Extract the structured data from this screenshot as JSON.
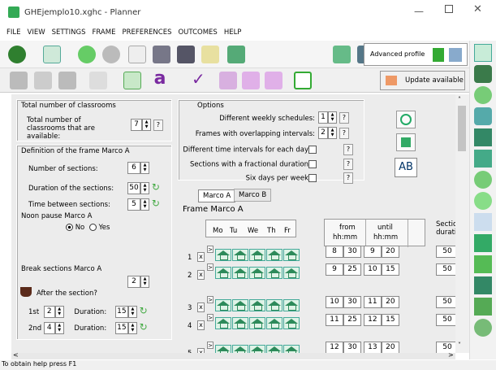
{
  "window": {
    "title": "GHEjemplo10.xghc - Planner"
  },
  "menu": [
    "FILE",
    "VIEW",
    "SETTINGS",
    "FRAME",
    "PREFERENCES",
    "OUTCOMES",
    "HELP"
  ],
  "toolbar": {
    "profile_label": "Advanced profile",
    "update_label": "Update available"
  },
  "classrooms": {
    "section_title": "Total number of classrooms",
    "label": "Total number of classrooms that are available:",
    "value": "7"
  },
  "frame_def": {
    "section_title": "Definition of the frame Marco A",
    "sections_label": "Number of sections:",
    "sections_value": "6",
    "duration_label": "Duration of the sections:",
    "duration_value": "50",
    "between_label": "Time between sections:",
    "between_value": "5"
  },
  "noon": {
    "title": "Noon pause Marco A",
    "no": "No",
    "yes": "Yes"
  },
  "breaks": {
    "title": "Break sections Marco A",
    "count": "2",
    "after_label": "After the section?",
    "rows": [
      {
        "label": "1st",
        "section": "2",
        "duration_label": "Duration:",
        "duration": "15"
      },
      {
        "label": "2nd",
        "section": "4",
        "duration_label": "Duration:",
        "duration": "15"
      }
    ]
  },
  "options": {
    "title": "Options",
    "items": [
      {
        "label": "Different weekly schedules:",
        "value": "1",
        "type": "spin"
      },
      {
        "label": "Frames with overlapping intervals:",
        "value": "2",
        "type": "spin"
      },
      {
        "label": "Different time intervals for each day",
        "type": "check"
      },
      {
        "label": "Sections with a fractional duration",
        "type": "check"
      },
      {
        "label": "Six days per week",
        "type": "check"
      }
    ]
  },
  "ab_label": "AB",
  "tabs": [
    "Marco A",
    "Marco B"
  ],
  "frame_title": "Frame  Marco A",
  "days": [
    "Mo",
    "Tu",
    "We",
    "Th",
    "Fr"
  ],
  "cols": {
    "from": "from",
    "until": "until",
    "hhmm": "hh:mm",
    "sections": "Sections",
    "duration": "duration"
  },
  "sections": [
    {
      "n": "1",
      "fh": "8",
      "fm": "30",
      "uh": "9",
      "um": "20",
      "dur": "50"
    },
    {
      "n": "2",
      "fh": "9",
      "fm": "25",
      "uh": "10",
      "um": "15",
      "dur": "50"
    },
    {
      "n": "3",
      "fh": "10",
      "fm": "30",
      "uh": "11",
      "um": "20",
      "dur": "50"
    },
    {
      "n": "4",
      "fh": "11",
      "fm": "25",
      "uh": "12",
      "um": "15",
      "dur": "50"
    },
    {
      "n": "5",
      "fh": "12",
      "fm": "30",
      "uh": "13",
      "um": "20",
      "dur": "50"
    }
  ],
  "status": "To obtain help press F1"
}
